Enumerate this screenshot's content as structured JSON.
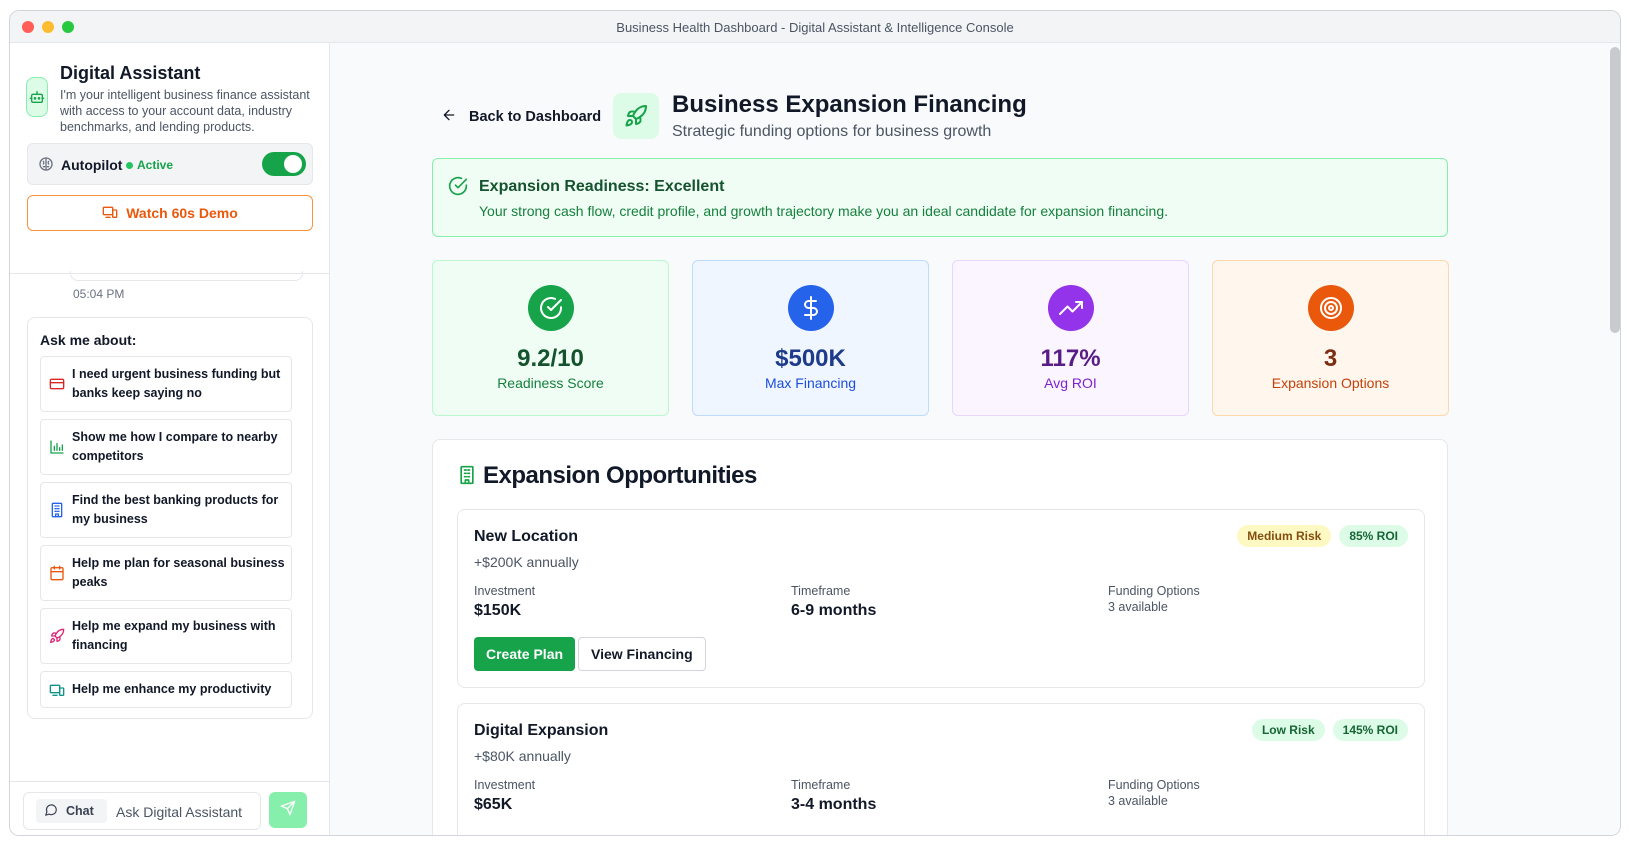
{
  "window": {
    "title": "Business Health Dashboard - Digital Assistant & Intelligence Console"
  },
  "sidebar": {
    "title": "Digital Assistant",
    "description": "I'm your intelligent business finance assistant with access to your account data, industry benchmarks, and lending products.",
    "autopilot": {
      "label": "Autopilot",
      "status": "Active",
      "enabled": true
    },
    "demo_button": "Watch 60s Demo",
    "last_message_time": "05:04 PM",
    "ask_title": "Ask me about:",
    "suggestions": [
      {
        "label": "I need urgent business funding but banks keep saying no",
        "icon": "credit-card-icon",
        "color": "#dc2626"
      },
      {
        "label": "Show me how I compare to nearby competitors",
        "icon": "bar-chart-icon",
        "color": "#16a34a"
      },
      {
        "label": "Find the best banking products for my business",
        "icon": "building-icon",
        "color": "#2563eb"
      },
      {
        "label": "Help me plan for seasonal business peaks",
        "icon": "calendar-icon",
        "color": "#ea580c"
      },
      {
        "label": "Help me expand my business with financing",
        "icon": "rocket-icon",
        "color": "#db2777"
      },
      {
        "label": "Help me enhance my productivity",
        "icon": "devices-icon",
        "color": "#0d9488"
      }
    ],
    "composer": {
      "chip": "Chat",
      "placeholder": "Ask Digital Assistant"
    }
  },
  "main": {
    "back_label": "Back to Dashboard",
    "title": "Business Expansion Financing",
    "subtitle": "Strategic funding options for business growth",
    "readiness": {
      "title": "Expansion Readiness: Excellent",
      "description": "Your strong cash flow, credit profile, and growth trajectory make you an ideal candidate for expansion financing."
    },
    "stats": [
      {
        "value": "9.2/10",
        "label": "Readiness Score",
        "icon": "check-circle-icon",
        "accent": "#16a34a",
        "bg": "#f0fdf4",
        "border": "#bbf7d0",
        "value_color": "#14532d",
        "label_color": "#15803d"
      },
      {
        "value": "$500K",
        "label": "Max Financing",
        "icon": "dollar-icon",
        "accent": "#2563eb",
        "bg": "#eff6ff",
        "border": "#bfdbfe",
        "value_color": "#1e3a8a",
        "label_color": "#1d4ed8"
      },
      {
        "value": "117%",
        "label": "Avg ROI",
        "icon": "trending-up-icon",
        "accent": "#9333ea",
        "bg": "#faf5ff",
        "border": "#e9d5ff",
        "value_color": "#581c87",
        "label_color": "#7e22ce"
      },
      {
        "value": "3",
        "label": "Expansion Options",
        "icon": "target-icon",
        "accent": "#ea580c",
        "bg": "#fff7ed",
        "border": "#fed7aa",
        "value_color": "#7c2d12",
        "label_color": "#c2410c"
      }
    ],
    "opportunities_title": "Expansion Opportunities",
    "opportunities": [
      {
        "name": "New Location",
        "return": "+$200K annually",
        "risk": "Medium Risk",
        "roi": "85% ROI",
        "investment_label": "Investment",
        "investment": "$150K",
        "timeframe_label": "Timeframe",
        "timeframe": "6-9 months",
        "funding_label": "Funding Options",
        "funding": "3 available",
        "plan_button": "Create Plan",
        "financing_button": "View Financing"
      },
      {
        "name": "Digital Expansion",
        "return": "+$80K annually",
        "risk": "Low Risk",
        "roi": "145% ROI",
        "investment_label": "Investment",
        "investment": "$65K",
        "timeframe_label": "Timeframe",
        "timeframe": "3-4 months",
        "funding_label": "Funding Options",
        "funding": "3 available"
      }
    ]
  }
}
